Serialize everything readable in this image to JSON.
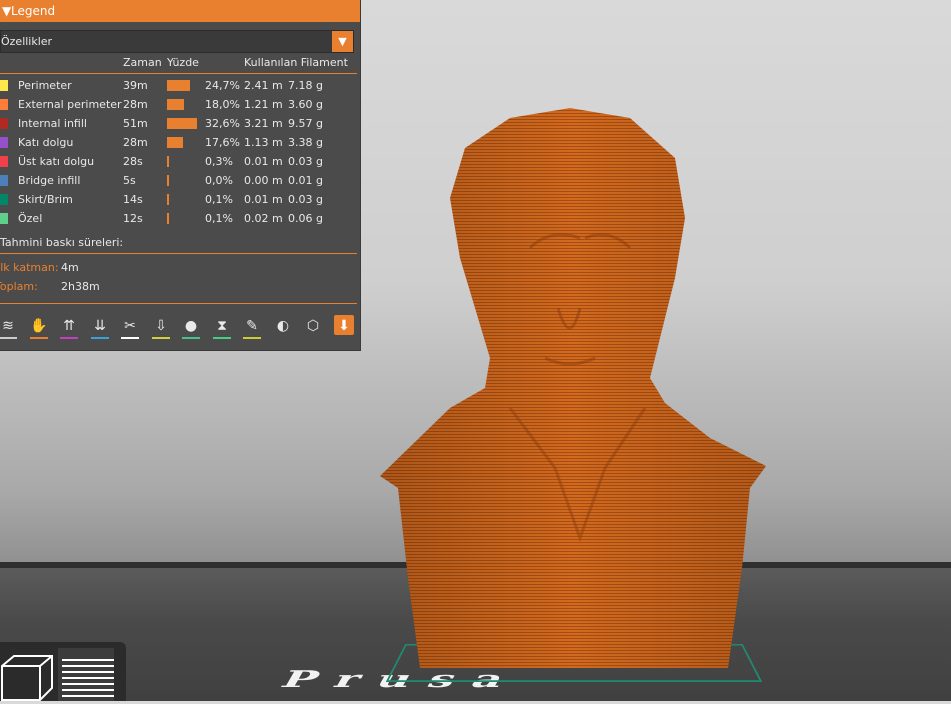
{
  "legend": {
    "title": "Legend",
    "dropdown_value": "Özellikler",
    "columns": {
      "time": "Zaman",
      "percent": "Yüzde",
      "filament": "Kullanılan Filament"
    },
    "rows": [
      {
        "name": "Perimeter",
        "time": "39m",
        "percent": "24,7%",
        "fraction": 0.247,
        "length": "2.41 m",
        "weight": "7.18 g",
        "color": "#FFE94A"
      },
      {
        "name": "External perimeter",
        "time": "28m",
        "percent": "18,0%",
        "fraction": 0.18,
        "length": "1.21 m",
        "weight": "3.60 g",
        "color": "#FF7D38"
      },
      {
        "name": "Internal infill",
        "time": "51m",
        "percent": "32,6%",
        "fraction": 0.326,
        "length": "3.21 m",
        "weight": "9.57 g",
        "color": "#B02A22"
      },
      {
        "name": "Katı dolgu",
        "time": "28m",
        "percent": "17,6%",
        "fraction": 0.176,
        "length": "1.13 m",
        "weight": "3.38 g",
        "color": "#9650CC"
      },
      {
        "name": "Üst katı dolgu",
        "time": "28s",
        "percent": "0,3%",
        "fraction": 0.003,
        "length": "0.01 m",
        "weight": "0.03 g",
        "color": "#F0404A"
      },
      {
        "name": "Bridge infill",
        "time": "5s",
        "percent": "0,0%",
        "fraction": 0.0,
        "length": "0.00 m",
        "weight": "0.01 g",
        "color": "#4D80BA"
      },
      {
        "name": "Skirt/Brim",
        "time": "14s",
        "percent": "0,1%",
        "fraction": 0.001,
        "length": "0.01 m",
        "weight": "0.03 g",
        "color": "#008866"
      },
      {
        "name": "Özel",
        "time": "12s",
        "percent": "0,1%",
        "fraction": 0.001,
        "length": "0.02 m",
        "weight": "0.06 g",
        "color": "#5ED08C"
      }
    ],
    "estimates_label": "Tahmini baskı süreleri:",
    "first_layer_label": "İlk katman:",
    "first_layer_value": "4m",
    "total_label": "Toplam:",
    "total_value": "2h38m"
  },
  "toolbar_icons": [
    "travel-icon",
    "wipe-icon",
    "retractions-icon",
    "deretractions-icon",
    "seams-icon",
    "tool-change-icon",
    "color-change-icon",
    "pause-icon",
    "custom-gcode-icon",
    "center-of-gravity-icon",
    "shells-icon",
    "tool-marker-icon"
  ],
  "bed_label": "Prusa",
  "accent_color": "#E8802F",
  "model_color": "#D2691E"
}
